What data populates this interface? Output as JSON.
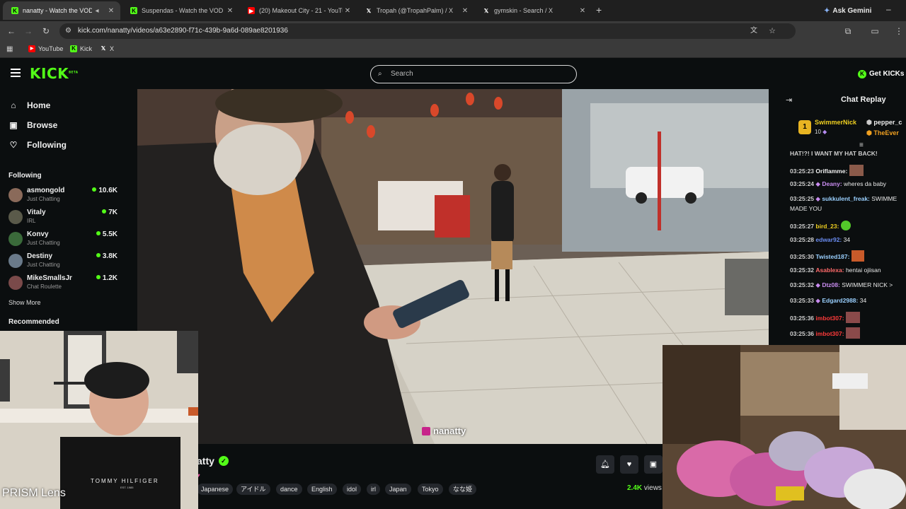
{
  "browser": {
    "tabs": [
      {
        "title": "nanatty - Watch the VOD on",
        "active": true,
        "favicon": "kick-icon"
      },
      {
        "title": "Suspendas - Watch the VOD on",
        "active": false,
        "favicon": "kick-icon"
      },
      {
        "title": "(20) Makeout City - 21 - YouTub",
        "active": false,
        "favicon": "youtube-icon"
      },
      {
        "title": "Tropah (@TropahPalm) / X",
        "active": false,
        "favicon": "x-icon"
      },
      {
        "title": "gymskin - Search / X",
        "active": false,
        "favicon": "x-icon"
      }
    ],
    "ask_gemini": "Ask Gemini",
    "url": "kick.com/nanatty/videos/a63e2890-f71c-439b-9a6d-089ae8201936",
    "bookmarks": [
      {
        "label": "YouTube"
      },
      {
        "label": "Kick"
      },
      {
        "label": "X"
      }
    ]
  },
  "header": {
    "logo": "KICK",
    "logo_sup": "BETA",
    "search_placeholder": "Search",
    "get_kicks": "Get KICKs"
  },
  "sidebar": {
    "nav": [
      {
        "label": "Home",
        "icon": "home-icon"
      },
      {
        "label": "Browse",
        "icon": "browse-icon"
      },
      {
        "label": "Following",
        "icon": "heart-icon"
      }
    ],
    "following_heading": "Following",
    "following": [
      {
        "name": "asmongold",
        "category": "Just Chatting",
        "viewers": "10.6K",
        "avatar_color": "#8a6a5a"
      },
      {
        "name": "Vitaly",
        "category": "IRL",
        "viewers": "7K",
        "avatar_color": "#5a5a4a"
      },
      {
        "name": "Konvy",
        "category": "Just Chatting",
        "viewers": "5.5K",
        "avatar_color": "#3a6a3a"
      },
      {
        "name": "Destiny",
        "category": "Just Chatting",
        "viewers": "3.8K",
        "avatar_color": "#6a7a8a"
      },
      {
        "name": "MikeSmallsJr",
        "category": "Chat Roulette",
        "viewers": "1.2K",
        "avatar_color": "#7a4a4a"
      }
    ],
    "show_more": "Show More",
    "recommended_heading": "Recommended"
  },
  "video": {
    "overlay_name": "nanatty"
  },
  "stream": {
    "channel_name": "atty",
    "tags": [
      "Japanese",
      "アイドル",
      "dance",
      "English",
      "idol",
      "irl",
      "Japan",
      "Tokyo",
      "なな姫"
    ],
    "views": "2.4K",
    "views_suffix": "views"
  },
  "chat": {
    "title": "Chat Replay",
    "pinned": [
      {
        "name": "SwimmerNick",
        "count": "10",
        "badge": "1"
      },
      {
        "name": "pepper_c",
        "count": ""
      },
      {
        "name": "TheEver",
        "count": ""
      }
    ],
    "top_fragment": "HAT!?! I WANT MY HAT BACK!",
    "messages": [
      {
        "time": "03:25:23",
        "user": "Oriflamme:",
        "text": "",
        "color": "#f0f0f0",
        "emote": true
      },
      {
        "time": "03:25:24",
        "user": "Deany:",
        "text": "wheres da baby",
        "color": "#c98cf0",
        "emote": false
      },
      {
        "time": "03:25:25",
        "user": "sukkulent_freak:",
        "text": "SWIMME",
        "color": "#c98cf0",
        "emote": false
      },
      {
        "time": "",
        "user": "",
        "text": "MADE YOU",
        "color": "#f0f0f0",
        "emote": false
      },
      {
        "time": "03:25:27",
        "user": "bird_23:",
        "text": "",
        "color": "#f0d020",
        "emote": true
      },
      {
        "time": "03:25:28",
        "user": "edwar92:",
        "text": "34",
        "color": "#6a8cf0",
        "emote": false
      },
      {
        "time": "03:25:30",
        "user": "Twisted187:",
        "text": "",
        "color": "#9ad0ff",
        "emote": true
      },
      {
        "time": "03:25:32",
        "user": "Asablexa:",
        "text": "hentai ojiisan",
        "color": "#ff6a6a",
        "emote": false
      },
      {
        "time": "03:25:32",
        "user": "Dtz08:",
        "text": "SWIMMER NICK >",
        "color": "#c98cf0",
        "emote": false
      },
      {
        "time": "03:25:33",
        "user": "Edgard2988:",
        "text": "34",
        "color": "#9ad0ff",
        "emote": false
      },
      {
        "time": "03:25:36",
        "user": "imbot307:",
        "text": "",
        "color": "#ff3a3a",
        "emote": true
      },
      {
        "time": "03:25:36",
        "user": "imbot307:",
        "text": "",
        "color": "#ff3a3a",
        "emote": true
      }
    ]
  },
  "webcam_left": {
    "shirt_text": "TOMMY HILFIGER",
    "shirt_sub": "EST. 1985",
    "overlay": "PRISM Lens"
  },
  "colors": {
    "kick_green": "#53fc18",
    "background": "#0b0e0f"
  }
}
